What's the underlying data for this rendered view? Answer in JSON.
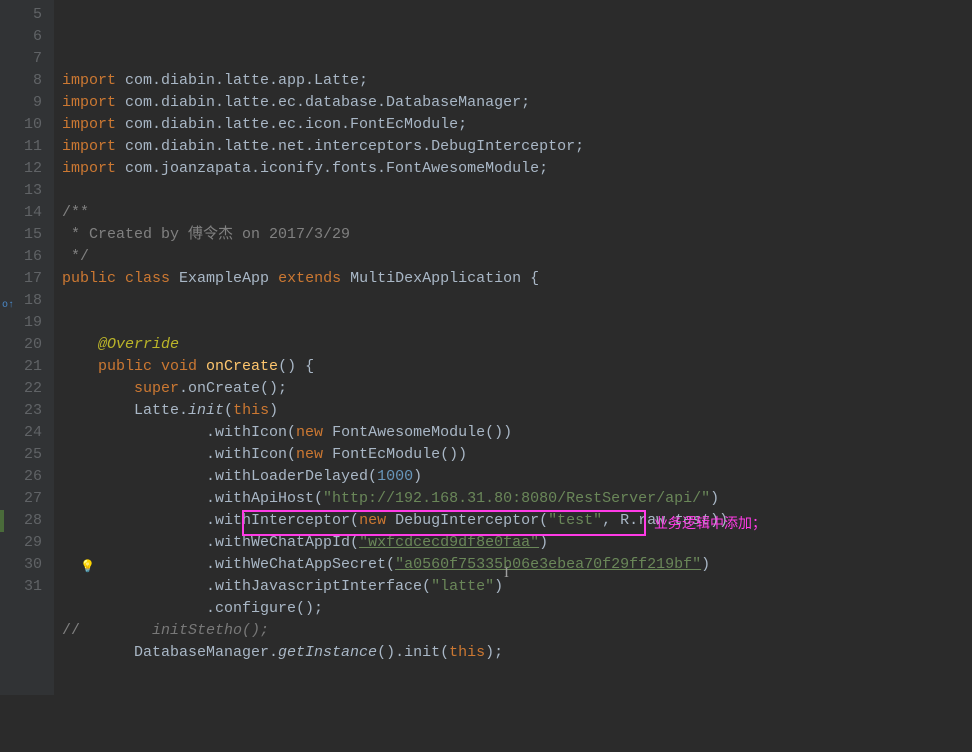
{
  "lines": [
    {
      "n": 5,
      "tokens": [
        [
          "kw",
          "import "
        ],
        [
          "",
          "com.diabin.latte.app.Latte;"
        ]
      ]
    },
    {
      "n": 6,
      "tokens": [
        [
          "kw",
          "import "
        ],
        [
          "",
          "com.diabin.latte.ec.database.DatabaseManager;"
        ]
      ]
    },
    {
      "n": 7,
      "tokens": [
        [
          "kw",
          "import "
        ],
        [
          "",
          "com.diabin.latte.ec.icon.FontEcModule;"
        ]
      ]
    },
    {
      "n": 8,
      "tokens": [
        [
          "kw",
          "import "
        ],
        [
          "",
          "com.diabin.latte.net.interceptors.DebugInterceptor;"
        ]
      ]
    },
    {
      "n": 9,
      "tokens": [
        [
          "kw",
          "import "
        ],
        [
          "",
          "com.joanzapata.iconify.fonts.FontAwesomeModule;"
        ]
      ]
    },
    {
      "n": 10,
      "tokens": [
        [
          "",
          ""
        ]
      ]
    },
    {
      "n": 11,
      "tokens": [
        [
          "cmt",
          "/**"
        ]
      ]
    },
    {
      "n": 12,
      "tokens": [
        [
          "cmt",
          " * Created by 傅令杰 on 2017/3/29"
        ]
      ]
    },
    {
      "n": 13,
      "tokens": [
        [
          "cmt",
          " */"
        ]
      ]
    },
    {
      "n": 14,
      "tokens": [
        [
          "kw",
          "public class "
        ],
        [
          "cls",
          "ExampleApp "
        ],
        [
          "kw",
          "extends "
        ],
        [
          "",
          "MultiDexApplication {"
        ]
      ]
    },
    {
      "n": 15,
      "tokens": [
        [
          "",
          ""
        ]
      ]
    },
    {
      "n": 16,
      "tokens": [
        [
          "",
          ""
        ]
      ]
    },
    {
      "n": 17,
      "tokens": [
        [
          "",
          "    "
        ],
        [
          "ann",
          "@Override"
        ]
      ]
    },
    {
      "n": 18,
      "tokens": [
        [
          "",
          "    "
        ],
        [
          "kw",
          "public void "
        ],
        [
          "func",
          "onCreate"
        ],
        [
          "",
          "() {"
        ]
      ]
    },
    {
      "n": 19,
      "tokens": [
        [
          "",
          "        "
        ],
        [
          "kw",
          "super"
        ],
        [
          "",
          ".onCreate();"
        ]
      ]
    },
    {
      "n": 20,
      "tokens": [
        [
          "",
          "        Latte."
        ],
        [
          "ital",
          "init"
        ],
        [
          "",
          "("
        ],
        [
          "kw",
          "this"
        ],
        [
          "",
          ")"
        ]
      ]
    },
    {
      "n": 21,
      "tokens": [
        [
          "",
          "                .withIcon("
        ],
        [
          "kw",
          "new "
        ],
        [
          "",
          "FontAwesomeModule())"
        ]
      ]
    },
    {
      "n": 22,
      "tokens": [
        [
          "",
          "                .withIcon("
        ],
        [
          "kw",
          "new "
        ],
        [
          "",
          "FontEcModule())"
        ]
      ]
    },
    {
      "n": 23,
      "tokens": [
        [
          "",
          "                .withLoaderDelayed("
        ],
        [
          "num",
          "1000"
        ],
        [
          "",
          ")"
        ]
      ]
    },
    {
      "n": 24,
      "tokens": [
        [
          "",
          "                .withApiHost("
        ],
        [
          "str",
          "\"http://192.168.31.80:8080/RestServer/api/\""
        ],
        [
          "",
          ")"
        ]
      ]
    },
    {
      "n": 25,
      "tokens": [
        [
          "",
          "                .withInterceptor("
        ],
        [
          "kw",
          "new "
        ],
        [
          "",
          "DebugInterceptor("
        ],
        [
          "str",
          "\"test\""
        ],
        [
          "",
          ", R.raw."
        ],
        [
          "ital",
          "test"
        ],
        [
          "",
          "))"
        ]
      ]
    },
    {
      "n": 26,
      "tokens": [
        [
          "",
          "                .withWeChatAppId("
        ],
        [
          "strund",
          "\"wxfcdcecd9df8e0faa\""
        ],
        [
          "",
          ")"
        ]
      ]
    },
    {
      "n": 27,
      "tokens": [
        [
          "",
          "                .withWeChatAppSecret("
        ],
        [
          "strund",
          "\"a0560f75335b06e3ebea70f29ff219bf\""
        ],
        [
          "",
          ")"
        ]
      ]
    },
    {
      "n": 28,
      "tokens": [
        [
          "",
          "                .withJavascriptInterface("
        ],
        [
          "str",
          "\"latte\""
        ],
        [
          "",
          ")"
        ]
      ]
    },
    {
      "n": 29,
      "tokens": [
        [
          "",
          "                .configure();"
        ]
      ]
    },
    {
      "n": 30,
      "tokens": [
        [
          "cmt",
          "//        "
        ],
        [
          "dim",
          "initStetho();"
        ]
      ]
    },
    {
      "n": 31,
      "tokens": [
        [
          "",
          "        DatabaseManager."
        ],
        [
          "ital",
          "getInstance"
        ],
        [
          "",
          "().init("
        ],
        [
          "kw",
          "this"
        ],
        [
          "",
          ");"
        ]
      ]
    }
  ],
  "annotation": {
    "callout_text": "业务逻辑中添加；",
    "highlighted_line": 28
  },
  "gutter_markers": {
    "override_line": 18,
    "bulb_line": 27,
    "modified_line": 28
  }
}
